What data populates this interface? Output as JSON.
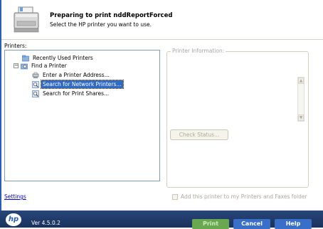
{
  "header": {
    "title": "Preparing to print nddReportForced",
    "subtitle": "Select the HP printer you want to use."
  },
  "printers": {
    "label": "Printers:",
    "items": [
      {
        "label": "Recently Used Printers",
        "icon": "folder-icon"
      },
      {
        "label": "Find a Printer",
        "icon": "folder-search-icon",
        "expander": "−"
      },
      {
        "label": "Enter a Printer Address...",
        "icon": "printer-network-icon"
      },
      {
        "label": "Search for Network Printers...",
        "icon": "magnifier-icon",
        "selected": true
      },
      {
        "label": "Search for Print Shares...",
        "icon": "magnifier-icon"
      }
    ]
  },
  "info": {
    "legend": "Printer Information:",
    "check_status_label": "Check Status...",
    "scroll_up": "▲",
    "scroll_down": "▼"
  },
  "settings_link": "Settings",
  "add_printer_label": "Add this printer to my Printers and Faxes folder",
  "footer": {
    "logo": "hp",
    "version": "Ver 4.5.0.2",
    "print_label": "Print",
    "cancel_label": "Cancel",
    "help_label": "Help"
  },
  "colors": {
    "selection": "#316ac5",
    "footer": "#1f3a68",
    "print_button": "#6aa84f",
    "action_button": "#3a6fc9"
  }
}
